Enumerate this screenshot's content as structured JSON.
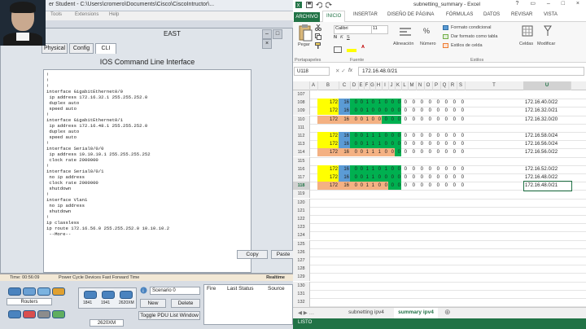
{
  "packet_tracer": {
    "window_title": "er Student - C:\\Users\\cromero\\Documents\\Cisco\\CiscoIntructor\\...",
    "menu": [
      "Tools",
      "Extensions",
      "Help"
    ],
    "device_window_title": "EAST",
    "tabs": [
      "Physical",
      "Config",
      "CLI"
    ],
    "cli_heading": "IOS Command Line Interface",
    "cli_text": "!\n!\n!\ninterface GigabitEthernet0/0\n ip address 172.16.32.1 255.255.252.0\n duplex auto\n speed auto\n!\ninterface GigabitEthernet0/1\n ip address 172.16.48.1 255.255.252.0\n duplex auto\n speed auto\n!\ninterface Serial0/0/0\n ip address 10.10.10.1 255.255.255.252\n clock rate 2000000\n!\ninterface Serial0/0/1\n no ip address\n clock rate 2000000\n shutdown\n!\ninterface Vlan1\n no ip address\n shutdown\n!\nip classless\nip route 172.16.56.0 255.255.252.0 10.10.10.2\n --More--",
    "copy_button": "Copy",
    "paste_button": "Paste",
    "status_time": "Time: 00:56:09",
    "status_actions": "Power Cycle Devices  Fast Forward Time",
    "realtime": "Realtime",
    "device_category": "Routers",
    "device_models": [
      "1841",
      "1941",
      "2620XM"
    ],
    "selected_model": "2620XM",
    "scenario": "Scenario 0",
    "new_button": "New",
    "delete_button": "Delete",
    "toggle_pdu": "Toggle PDU List Window",
    "pdu_columns": [
      "Fire",
      "Last Status",
      "Source"
    ]
  },
  "excel": {
    "window_title": "subnetting_summary - Excel",
    "tabs": [
      "ARCHIVO",
      "INICIO",
      "INSERTAR",
      "DISEÑO DE PÁGINA",
      "FÓRMULAS",
      "DATOS",
      "REVISAR",
      "VISTA"
    ],
    "ribbon": {
      "paste": "Pegar",
      "clipboard_group": "Portapapeles",
      "font_group": "Fuente",
      "font_name": "Calibri",
      "font_size": "11",
      "alignment": "Alineación",
      "number": "Número",
      "styles_group": "Estilos",
      "conditional": "Formato condicional",
      "table_format": "Dar formato como tabla",
      "cell_styles": "Estilos de celda",
      "cells": "Celdas",
      "edit": "Modificar",
      "percent": "%"
    },
    "name_box": "U118",
    "fx": "fx",
    "formula": "172.16.48.0/21",
    "columns": [
      "A",
      "B",
      "C",
      "D",
      "E",
      "F",
      "G",
      "H",
      "I",
      "J",
      "K",
      "L",
      "M",
      "N",
      "O",
      "P",
      "Q",
      "R",
      "S",
      "T",
      "U"
    ],
    "rows": [
      {
        "num": "107",
        "cells": []
      },
      {
        "num": "108",
        "cells": [
          "172",
          "16",
          "0",
          "0",
          "1",
          "0",
          "1",
          "0",
          "0",
          "0",
          "0",
          "0",
          "0",
          "0",
          "0",
          "0",
          "0",
          "0",
          "172.16.40.0/22"
        ],
        "fills": [
          "#ffff00",
          "#5b9bd5",
          "#00b050",
          "#00b050",
          "#00b050",
          "#00b050",
          "#00b050",
          "#00b050",
          "#00b050",
          "#00b050"
        ]
      },
      {
        "num": "109",
        "cells": [
          "172",
          "16",
          "0",
          "0",
          "1",
          "0",
          "0",
          "0",
          "0",
          "0",
          "0",
          "0",
          "0",
          "0",
          "0",
          "0",
          "0",
          "0",
          "172.16.32.0/21"
        ],
        "fills": [
          "#ffff00",
          "#5b9bd5",
          "#00b050",
          "#00b050",
          "#00b050",
          "#00b050",
          "#00b050",
          "#00b050",
          "#00b050",
          "#00b050"
        ]
      },
      {
        "num": "110",
        "cells": [
          "172",
          "16",
          "0",
          "0",
          "1",
          "0",
          "0",
          "0",
          "0",
          "0",
          "0",
          "0",
          "0",
          "0",
          "0",
          "0",
          "0",
          "0",
          "172.16.32.0/20"
        ],
        "fills": [
          "#f4b183",
          "#f4b183",
          "#f4b183",
          "#f4b183",
          "#f4b183",
          "#f4b183",
          "#f4b183",
          "#00b050",
          "#00b050",
          "#00b050"
        ]
      },
      {
        "num": "111",
        "cells": []
      },
      {
        "num": "112",
        "cells": [
          "172",
          "16",
          "0",
          "0",
          "1",
          "1",
          "1",
          "0",
          "0",
          "0",
          "0",
          "0",
          "0",
          "0",
          "0",
          "0",
          "0",
          "0",
          "172.16.58.0/24"
        ],
        "fills": [
          "#ffff00",
          "#5b9bd5",
          "#00b050",
          "#00b050",
          "#00b050",
          "#00b050",
          "#00b050",
          "#00b050",
          "#00b050",
          "#00b050"
        ]
      },
      {
        "num": "113",
        "cells": [
          "172",
          "16",
          "0",
          "0",
          "1",
          "1",
          "1",
          "0",
          "0",
          "0",
          "0",
          "0",
          "0",
          "0",
          "0",
          "0",
          "0",
          "0",
          "172.16.56.0/24"
        ],
        "fills": [
          "#ffff00",
          "#5b9bd5",
          "#00b050",
          "#00b050",
          "#00b050",
          "#00b050",
          "#00b050",
          "#00b050",
          "#00b050",
          "#00b050"
        ]
      },
      {
        "num": "114",
        "cells": [
          "172",
          "16",
          "0",
          "0",
          "1",
          "1",
          "1",
          "0",
          "0",
          "0",
          "0",
          "0",
          "0",
          "0",
          "0",
          "0",
          "0",
          "0",
          "172.16.56.0/22"
        ],
        "fills": [
          "#f4b183",
          "#f4b183",
          "#f4b183",
          "#f4b183",
          "#f4b183",
          "#f4b183",
          "#f4b183",
          "#f4b183",
          "#f4b183",
          "#00b050"
        ]
      },
      {
        "num": "115",
        "cells": []
      },
      {
        "num": "116",
        "cells": [
          "172",
          "16",
          "0",
          "0",
          "1",
          "1",
          "0",
          "1",
          "0",
          "0",
          "0",
          "0",
          "0",
          "0",
          "0",
          "0",
          "0",
          "0",
          "172.16.52.0/22"
        ],
        "fills": [
          "#ffff00",
          "#5b9bd5",
          "#00b050",
          "#00b050",
          "#00b050",
          "#00b050",
          "#00b050",
          "#00b050",
          "#00b050",
          "#00b050"
        ]
      },
      {
        "num": "117",
        "cells": [
          "172",
          "16",
          "0",
          "0",
          "1",
          "1",
          "0",
          "0",
          "0",
          "0",
          "0",
          "0",
          "0",
          "0",
          "0",
          "0",
          "0",
          "0",
          "172.16.48.0/22"
        ],
        "fills": [
          "#ffff00",
          "#5b9bd5",
          "#00b050",
          "#00b050",
          "#00b050",
          "#00b050",
          "#00b050",
          "#00b050",
          "#00b050",
          "#00b050"
        ]
      },
      {
        "num": "118",
        "cells": [
          "172",
          "16",
          "0",
          "0",
          "1",
          "1",
          "0",
          "0",
          "0",
          "0",
          "0",
          "0",
          "0",
          "0",
          "0",
          "0",
          "0",
          "0",
          "172.16.48.0/21"
        ],
        "fills": [
          "#f4b183",
          "#f4b183",
          "#f4b183",
          "#f4b183",
          "#f4b183",
          "#f4b183",
          "#f4b183",
          "#f4b183",
          "#00b050",
          "#00b050"
        ]
      },
      {
        "num": "119",
        "cells": []
      },
      {
        "num": "120",
        "cells": []
      },
      {
        "num": "121",
        "cells": []
      },
      {
        "num": "122",
        "cells": []
      },
      {
        "num": "123",
        "cells": []
      },
      {
        "num": "124",
        "cells": []
      },
      {
        "num": "125",
        "cells": []
      },
      {
        "num": "126",
        "cells": []
      },
      {
        "num": "127",
        "cells": []
      },
      {
        "num": "128",
        "cells": []
      },
      {
        "num": "129",
        "cells": []
      },
      {
        "num": "130",
        "cells": []
      },
      {
        "num": "131",
        "cells": []
      },
      {
        "num": "132",
        "cells": []
      },
      {
        "num": "133",
        "cells": []
      },
      {
        "num": "134",
        "cells": []
      },
      {
        "num": "135",
        "cells": []
      }
    ],
    "sheet_tabs": [
      "subnetting ipv4",
      "summary ipv4"
    ],
    "active_sheet": "summary ipv4",
    "status": "LISTO"
  }
}
